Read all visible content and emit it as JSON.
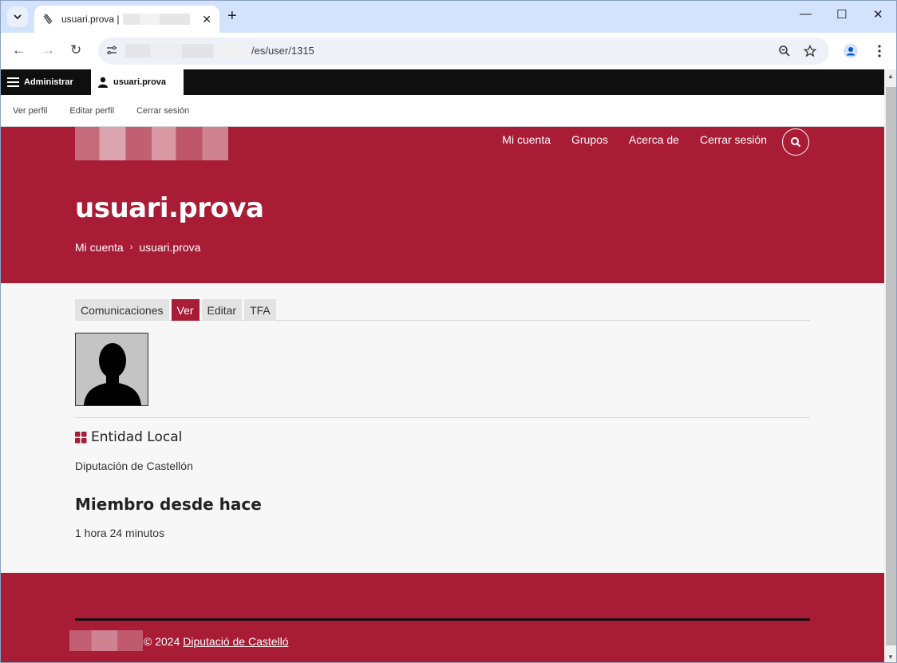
{
  "browser": {
    "tab_title": "usuari.prova |",
    "address_path": "/es/user/1315",
    "icons": {
      "tab_search": "chevron-down-icon",
      "new_tab": "plus-icon",
      "minimize": "minimize-icon",
      "maximize": "maximize-icon",
      "close": "close-icon",
      "back": "back-arrow-icon",
      "forward": "forward-arrow-icon",
      "reload": "reload-icon",
      "site_info": "tune-icon",
      "zoom": "zoom-icon",
      "bookmark": "star-icon",
      "profile": "profile-icon",
      "menu": "kebab-menu-icon"
    }
  },
  "admin_toolbar": {
    "admin_label": "Administrar",
    "user_label": "usuari.prova",
    "tray": [
      "Ver perfil",
      "Editar perfil",
      "Cerrar sesión"
    ]
  },
  "header": {
    "nav": [
      "Mi cuenta",
      "Grupos",
      "Acerca de",
      "Cerrar sesión"
    ],
    "title": "usuari.prova",
    "breadcrumb": {
      "home": "Mi cuenta",
      "separator": "›",
      "current": "usuari.prova"
    }
  },
  "content": {
    "tabs": [
      {
        "label": "Comunicaciones",
        "active": false
      },
      {
        "label": "Ver",
        "active": true
      },
      {
        "label": "Editar",
        "active": false
      },
      {
        "label": "TFA",
        "active": false
      }
    ],
    "entity_label": "Entidad Local",
    "entity_value": "Diputación de Castellón",
    "member_heading": "Miembro desde hace",
    "member_value": "1 hora 24 minutos"
  },
  "footer": {
    "copyright": "© 2024",
    "link_text": "Diputació de Castelló"
  },
  "colors": {
    "brand": "#a81c36",
    "admin_bar": "#0f0f0f"
  }
}
